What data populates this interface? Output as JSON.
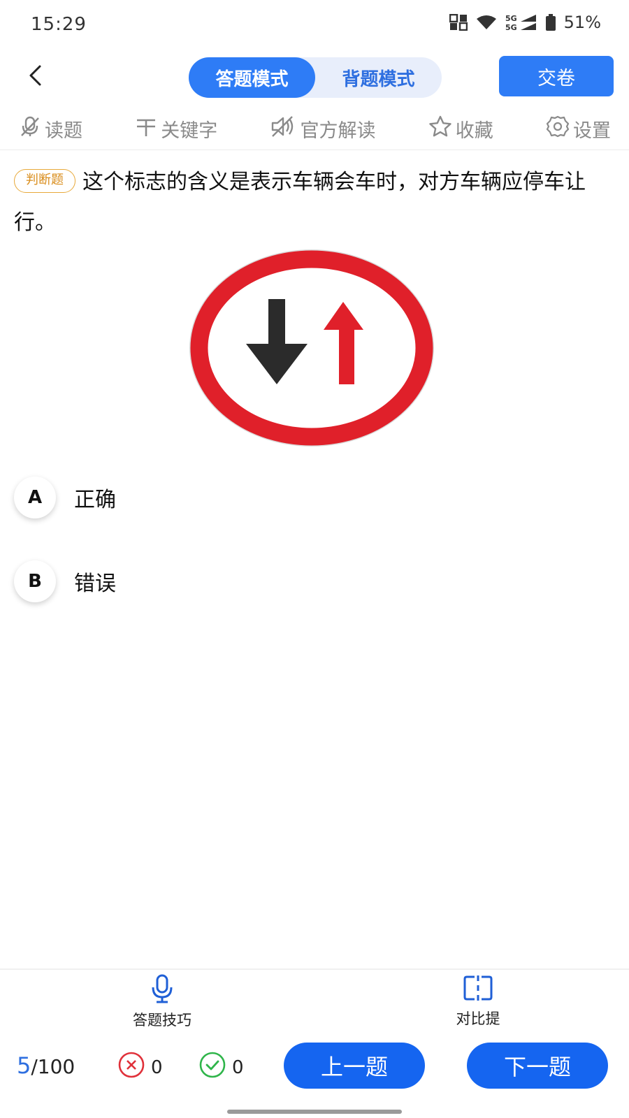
{
  "status": {
    "time": "15:29",
    "network": "5G",
    "battery": "51%"
  },
  "header": {
    "back_icon": "chevron-left-icon",
    "modes": [
      "答题模式",
      "背题模式"
    ],
    "active_mode": "答题模式",
    "submit_label": "交卷"
  },
  "toolbar": {
    "items": [
      {
        "label": "读题",
        "icon": "mute-mic-icon"
      },
      {
        "label": "关键字",
        "icon": "text-highlight-icon"
      },
      {
        "label": "官方解读",
        "icon": "speaker-mute-icon"
      },
      {
        "label": "收藏",
        "icon": "star-icon"
      },
      {
        "label": "设置",
        "icon": "gear-icon"
      }
    ]
  },
  "question": {
    "type_badge": "判断题",
    "text": "这个标志的含义是表示车辆会车时，对方车辆应停车让行。"
  },
  "options": [
    {
      "key": "A",
      "text": "正确"
    },
    {
      "key": "B",
      "text": "错误"
    }
  ],
  "footer": {
    "tips": [
      {
        "label": "答题技巧",
        "icon": "microphone-icon"
      },
      {
        "label": "对比提",
        "icon": "compare-icon"
      }
    ],
    "progress_current": "5",
    "progress_total": "/100",
    "wrong_count": "0",
    "right_count": "0",
    "prev_label": "上一题",
    "next_label": "下一题"
  },
  "colors": {
    "accent": "#2e7cf6",
    "nav_button": "#1565f0",
    "badge": "#e8a93a",
    "sign_red": "#e0202a",
    "wrong": "#e0313a",
    "right": "#2fb54a"
  }
}
